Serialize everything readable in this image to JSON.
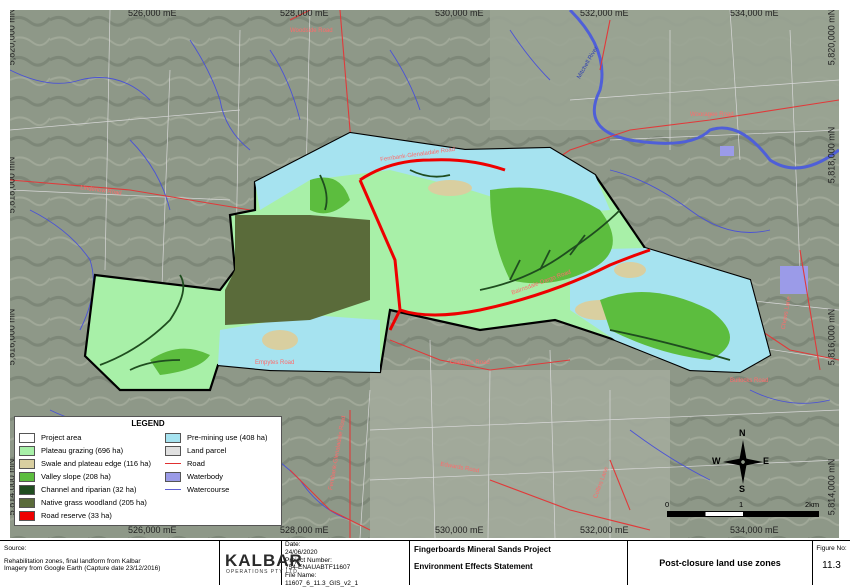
{
  "coordinates": {
    "eastings": [
      "526,000 mE",
      "528,000 mE",
      "530,000 mE",
      "532,000 mE",
      "534,000 mE"
    ],
    "northings": [
      "5,820,000 mN",
      "5,818,000 mN",
      "5,816,000 mN",
      "5,814,000 mN"
    ]
  },
  "road_labels": {
    "woodside": "Woodside Road",
    "mitchell": "Mitchell River",
    "wuk": "Wuk Wuk Road",
    "wooragee": "Wooragee Road",
    "fernbank": "Fernbank-Glenaladale Road",
    "bairnsdale": "Bairnsdale-Dargo Road",
    "lindenow": "Lindenow Road",
    "empty1": "Empytes Road",
    "chelton": "Cheltons Road",
    "edwards": "Edwards Road",
    "bullock": "Bullocks Road",
    "collins": "Collins Lane",
    "chews": "Chews Lane",
    "fernbank_vert": "Fernbank-Glenaladale Road"
  },
  "legend": {
    "title": "LEGEND",
    "items_left": [
      {
        "label": "Project area",
        "color": "#ffffff",
        "kind": "box"
      },
      {
        "label": "Plateau grazing (696 ha)",
        "color": "#a8f0a8",
        "kind": "box"
      },
      {
        "label": "Swale and plateau edge (116 ha)",
        "color": "#d9cfa0",
        "kind": "box"
      },
      {
        "label": "Valley slope (208 ha)",
        "color": "#5cbd3e",
        "kind": "box"
      },
      {
        "label": "Channel and riparian (32 ha)",
        "color": "#1f4d1f",
        "kind": "box"
      },
      {
        "label": "Native grass woodland (205 ha)",
        "color": "#5a6b3a",
        "kind": "box"
      },
      {
        "label": "Road reserve (33 ha)",
        "color": "#ee0000",
        "kind": "box"
      }
    ],
    "items_right": [
      {
        "label": "Pre-mining use (408 ha)",
        "color": "#a6e3f0",
        "kind": "box"
      },
      {
        "label": "Land parcel",
        "color": "#e0e0e0",
        "kind": "box"
      },
      {
        "label": "Road",
        "color": "#e03030",
        "kind": "line"
      },
      {
        "label": "Waterbody",
        "color": "#9b9be8",
        "kind": "box"
      },
      {
        "label": "Watercourse",
        "color": "#6060d0",
        "kind": "line"
      }
    ]
  },
  "north_arrow": {
    "n": "N",
    "e": "E",
    "s": "S",
    "w": "W"
  },
  "scale_bar": {
    "zero": "0",
    "one": "1",
    "two": "2km"
  },
  "title_block": {
    "source_label": "Source:",
    "source_line1": "Rehabilitation zones, final landform from Kalbar",
    "source_line2": "Imagery from Google Earth (Capture date 23/12/2016)",
    "logo": "KALBAR",
    "logo_sub": "OPERATIONS PTY LTD",
    "date_label": "Date:",
    "date_value": "24/06/2020",
    "project_number_label": "Project Number:",
    "project_number_value": "754-ENAUABTF11607",
    "file_name_label": "File Name:",
    "file_name_value": "11607_6_11.3_GIS_v2_1",
    "project_title": "Fingerboards Mineral Sands Project",
    "report_title": "Environment Effects Statement",
    "figure_title": "Post-closure land use zones",
    "figure_no_label": "Figure No:",
    "figure_no_value": "11.3"
  }
}
